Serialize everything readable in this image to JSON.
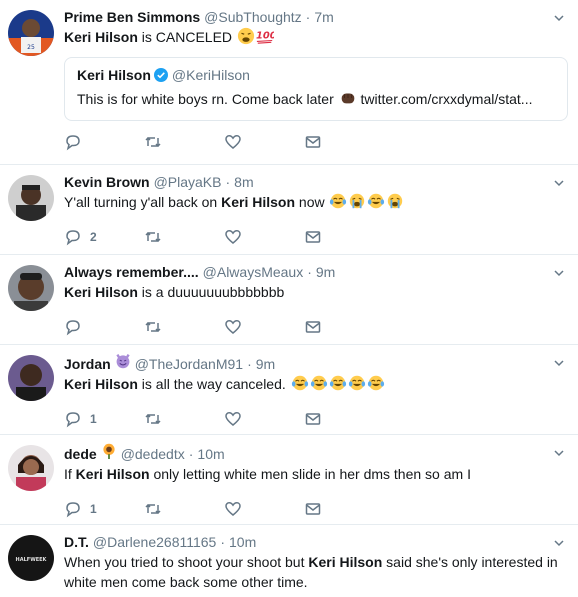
{
  "tweets": [
    {
      "name": "Prime Ben Simmons",
      "handle": "@SubThoughtz",
      "time": "7m",
      "segments": [
        {
          "text": "Keri Hilson",
          "bold": true
        },
        {
          "text": " is CANCELED ",
          "bold": false
        }
      ],
      "emojis": [
        "tired-face-emoji",
        "hundred-points-emoji"
      ],
      "reply_count": "",
      "quote": {
        "name": "Keri Hilson",
        "handle": "@KeriHilson",
        "text_before": "This is for white boys rn. Come back later ",
        "emoji": "fist-emoji",
        "text_after": " twitter.com/crxxdymal/stat..."
      }
    },
    {
      "name": "Kevin Brown",
      "handle": "@PlayaKB",
      "time": "8m",
      "segments": [
        {
          "text": "Y'all turning y'all back on ",
          "bold": false
        },
        {
          "text": "Keri Hilson",
          "bold": true
        },
        {
          "text": " now ",
          "bold": false
        }
      ],
      "emojis": [
        "joy-emoji",
        "sob-emoji",
        "joy-emoji",
        "sob-emoji"
      ],
      "reply_count": "2"
    },
    {
      "name": "Always remember....",
      "handle": "@AlwaysMeaux",
      "time": "9m",
      "segments": [
        {
          "text": "Keri Hilson",
          "bold": true
        },
        {
          "text": " is a duuuuuuubbbbbbb",
          "bold": false
        }
      ],
      "emojis": [],
      "reply_count": ""
    },
    {
      "name": "Jordan",
      "name_emoji": "smiling-imp-emoji",
      "handle": "@TheJordanM91",
      "time": "9m",
      "segments": [
        {
          "text": "Keri Hilson",
          "bold": true
        },
        {
          "text": " is all the way canceled. ",
          "bold": false
        }
      ],
      "emojis": [
        "joy-emoji",
        "joy-emoji",
        "joy-emoji",
        "joy-emoji",
        "joy-emoji"
      ],
      "reply_count": "1"
    },
    {
      "name": "dede",
      "name_emoji": "sunflower-emoji",
      "handle": "@dededtx",
      "time": "10m",
      "segments": [
        {
          "text": "If ",
          "bold": false
        },
        {
          "text": "Keri Hilson",
          "bold": true
        },
        {
          "text": " only letting white men slide in her dms then so am I",
          "bold": false
        }
      ],
      "emojis": [],
      "reply_count": "1"
    },
    {
      "name": "D.T.",
      "handle": "@Darlene26811165",
      "time": "10m",
      "segments": [
        {
          "text": "When you tried to shoot your shoot but ",
          "bold": false
        },
        {
          "text": "Keri Hilson",
          "bold": true
        },
        {
          "text": " said she's only interested in white men come back some other time.",
          "bold": false
        }
      ],
      "emojis": [],
      "reply_count": "",
      "avatar_text": "HALFWEEK"
    }
  ],
  "colors": {
    "text": "#14171a",
    "muted": "#657786",
    "border": "#e6ecf0",
    "verified": "#1da1f2"
  },
  "icons": [
    "reply-icon",
    "retweet-icon",
    "like-icon",
    "direct-message-icon",
    "caret-down-icon",
    "verified-icon"
  ],
  "separator": "·"
}
